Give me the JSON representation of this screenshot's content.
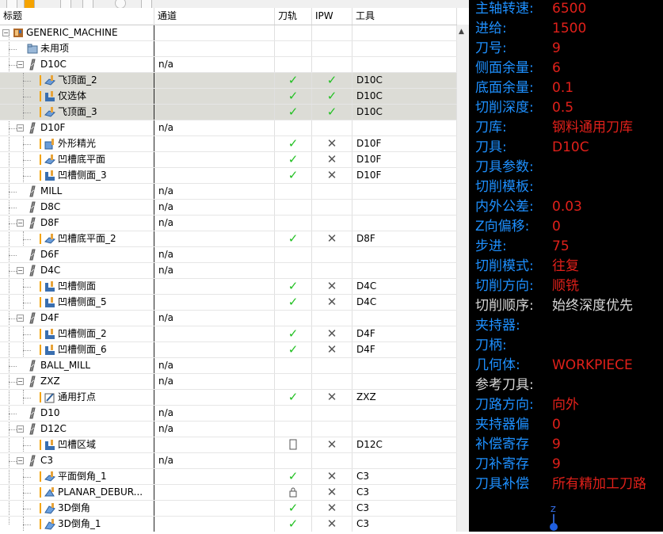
{
  "columns": {
    "title": "标题",
    "path": "通道",
    "toolpath": "刀轨",
    "ipw": "IPW",
    "tool": "工具"
  },
  "rows": [
    {
      "indent": 0,
      "type": "machine",
      "expand": "-",
      "name": "GENERIC_MACHINE",
      "path": "",
      "tp": "",
      "ipw": "",
      "tool": ""
    },
    {
      "indent": 1,
      "type": "folder",
      "expand": "",
      "name": "未用项",
      "path": "",
      "tp": "",
      "ipw": "",
      "tool": ""
    },
    {
      "indent": 1,
      "type": "tool",
      "expand": "-",
      "name": "D10C",
      "path": "n/a",
      "tp": "",
      "ipw": "",
      "tool": ""
    },
    {
      "indent": 2,
      "type": "op1",
      "expand": "",
      "name": "飞顶面_2",
      "path": "",
      "tp": "check",
      "ipw": "check",
      "tool": "D10C",
      "sel": true
    },
    {
      "indent": 2,
      "type": "op2",
      "expand": "",
      "name": "仅选体",
      "path": "",
      "tp": "check",
      "ipw": "check",
      "tool": "D10C",
      "sel": true
    },
    {
      "indent": 2,
      "type": "op1",
      "expand": "",
      "name": "飞顶面_3",
      "path": "",
      "tp": "check",
      "ipw": "check",
      "tool": "D10C",
      "sel": true
    },
    {
      "indent": 1,
      "type": "tool",
      "expand": "-",
      "name": "D10F",
      "path": "n/a",
      "tp": "",
      "ipw": "",
      "tool": ""
    },
    {
      "indent": 2,
      "type": "op3",
      "expand": "",
      "name": "外形精光",
      "path": "",
      "tp": "check",
      "ipw": "cross",
      "tool": "D10F"
    },
    {
      "indent": 2,
      "type": "op1",
      "expand": "",
      "name": "凹槽底平面",
      "path": "",
      "tp": "check",
      "ipw": "cross",
      "tool": "D10F"
    },
    {
      "indent": 2,
      "type": "op2",
      "expand": "",
      "name": "凹槽侧面_3",
      "path": "",
      "tp": "check",
      "ipw": "cross",
      "tool": "D10F"
    },
    {
      "indent": 1,
      "type": "tool",
      "expand": "",
      "name": "MILL",
      "path": "n/a",
      "tp": "",
      "ipw": "",
      "tool": ""
    },
    {
      "indent": 1,
      "type": "tool",
      "expand": "",
      "name": "D8C",
      "path": "n/a",
      "tp": "",
      "ipw": "",
      "tool": ""
    },
    {
      "indent": 1,
      "type": "tool",
      "expand": "-",
      "name": "D8F",
      "path": "n/a",
      "tp": "",
      "ipw": "",
      "tool": ""
    },
    {
      "indent": 2,
      "type": "op1",
      "expand": "",
      "name": "凹槽底平面_2",
      "path": "",
      "tp": "check",
      "ipw": "cross",
      "tool": "D8F"
    },
    {
      "indent": 1,
      "type": "tool",
      "expand": "",
      "name": "D6F",
      "path": "n/a",
      "tp": "",
      "ipw": "",
      "tool": ""
    },
    {
      "indent": 1,
      "type": "tool",
      "expand": "-",
      "name": "D4C",
      "path": "n/a",
      "tp": "",
      "ipw": "",
      "tool": ""
    },
    {
      "indent": 2,
      "type": "op2",
      "expand": "",
      "name": "凹槽侧面",
      "path": "",
      "tp": "check",
      "ipw": "cross",
      "tool": "D4C"
    },
    {
      "indent": 2,
      "type": "op2",
      "expand": "",
      "name": "凹槽侧面_5",
      "path": "",
      "tp": "check",
      "ipw": "cross",
      "tool": "D4C"
    },
    {
      "indent": 1,
      "type": "tool",
      "expand": "-",
      "name": "D4F",
      "path": "n/a",
      "tp": "",
      "ipw": "",
      "tool": ""
    },
    {
      "indent": 2,
      "type": "op2",
      "expand": "",
      "name": "凹槽侧面_2",
      "path": "",
      "tp": "check",
      "ipw": "cross",
      "tool": "D4F"
    },
    {
      "indent": 2,
      "type": "op2",
      "expand": "",
      "name": "凹槽侧面_6",
      "path": "",
      "tp": "check",
      "ipw": "cross",
      "tool": "D4F"
    },
    {
      "indent": 1,
      "type": "tool",
      "expand": "",
      "name": "BALL_MILL",
      "path": "n/a",
      "tp": "",
      "ipw": "",
      "tool": ""
    },
    {
      "indent": 1,
      "type": "tool",
      "expand": "-",
      "name": "ZXZ",
      "path": "n/a",
      "tp": "",
      "ipw": "",
      "tool": ""
    },
    {
      "indent": 2,
      "type": "op4",
      "expand": "",
      "name": "通用打点",
      "path": "",
      "tp": "check",
      "ipw": "cross",
      "tool": "ZXZ"
    },
    {
      "indent": 1,
      "type": "tool",
      "expand": "",
      "name": "D10",
      "path": "n/a",
      "tp": "",
      "ipw": "",
      "tool": ""
    },
    {
      "indent": 1,
      "type": "tool",
      "expand": "-",
      "name": "D12C",
      "path": "n/a",
      "tp": "",
      "ipw": "",
      "tool": ""
    },
    {
      "indent": 2,
      "type": "op2",
      "expand": "",
      "name": "凹槽区域",
      "path": "",
      "tp": "empty",
      "ipw": "cross",
      "tool": "D12C"
    },
    {
      "indent": 1,
      "type": "tool",
      "expand": "-",
      "name": "C3",
      "path": "n/a",
      "tp": "",
      "ipw": "",
      "tool": ""
    },
    {
      "indent": 2,
      "type": "op1",
      "expand": "",
      "name": "平面倒角_1",
      "path": "",
      "tp": "check",
      "ipw": "cross",
      "tool": "C3"
    },
    {
      "indent": 2,
      "type": "op5",
      "expand": "",
      "name": "PLANAR_DEBUR...",
      "path": "",
      "tp": "lock",
      "ipw": "cross",
      "tool": "C3"
    },
    {
      "indent": 2,
      "type": "op6",
      "expand": "",
      "name": "3D倒角",
      "path": "",
      "tp": "check",
      "ipw": "cross",
      "tool": "C3"
    },
    {
      "indent": 2,
      "type": "op6",
      "expand": "",
      "name": "3D倒角_1",
      "path": "",
      "tp": "check",
      "ipw": "cross",
      "tool": "C3"
    }
  ],
  "params": [
    {
      "k": "主轴转速:",
      "v": "6500",
      "kc": "blue",
      "vc": "red"
    },
    {
      "k": "进给:",
      "v": "1500",
      "kc": "blue",
      "vc": "red"
    },
    {
      "k": "刀号:",
      "v": "9",
      "kc": "blue",
      "vc": "red"
    },
    {
      "k": "侧面余量:",
      "v": "6",
      "kc": "blue",
      "vc": "red"
    },
    {
      "k": "底面余量:",
      "v": "0.1",
      "kc": "blue",
      "vc": "red"
    },
    {
      "k": "切削深度:",
      "v": "0.5",
      "kc": "blue",
      "vc": "red"
    },
    {
      "k": "刀库:",
      "v": "钢料通用刀库",
      "kc": "blue",
      "vc": "red"
    },
    {
      "k": "刀具:",
      "v": "D10C",
      "kc": "blue",
      "vc": "red"
    },
    {
      "k": "刀具参数:",
      "v": "",
      "kc": "blue",
      "vc": "red"
    },
    {
      "k": "切削模板:",
      "v": "",
      "kc": "blue",
      "vc": "red"
    },
    {
      "k": "内外公差:",
      "v": "0.03",
      "kc": "blue",
      "vc": "red"
    },
    {
      "k": "Z向偏移:",
      "v": "0",
      "kc": "blue",
      "vc": "red"
    },
    {
      "k": "步进:",
      "v": "75",
      "kc": "blue",
      "vc": "red"
    },
    {
      "k": "切削模式:",
      "v": "往复",
      "kc": "blue",
      "vc": "red"
    },
    {
      "k": "切削方向:",
      "v": "顺铣",
      "kc": "blue",
      "vc": "red"
    },
    {
      "k": "切削顺序:",
      "v": "始终深度优先",
      "kc": "white",
      "vc": "white"
    },
    {
      "k": "夹持器:",
      "v": "",
      "kc": "blue",
      "vc": "red"
    },
    {
      "k": "刀柄:",
      "v": "",
      "kc": "blue",
      "vc": "red"
    },
    {
      "k": "几何体:",
      "v": "WORKPIECE",
      "kc": "blue",
      "vc": "red"
    },
    {
      "k": "参考刀具:",
      "v": "",
      "kc": "white",
      "vc": "white"
    },
    {
      "k": "刀路方向:",
      "v": "向外",
      "kc": "blue",
      "vc": "red"
    },
    {
      "k": "夹持器偏",
      "v": "0",
      "kc": "blue",
      "vc": "red"
    },
    {
      "k": "补偿寄存",
      "v": "9",
      "kc": "blue",
      "vc": "red"
    },
    {
      "k": "刀补寄存",
      "v": "9",
      "kc": "blue",
      "vc": "red"
    },
    {
      "k": "刀具补偿",
      "v": "所有精加工刀路",
      "kc": "blue",
      "vc": "red"
    }
  ],
  "axis_label": "Z",
  "colors": {
    "key_blue": "#1e90ff",
    "value_red": "#e0201a",
    "check_green": "#22c022",
    "selection": "#dcdcd6",
    "bar_orange": "#f5a300"
  }
}
